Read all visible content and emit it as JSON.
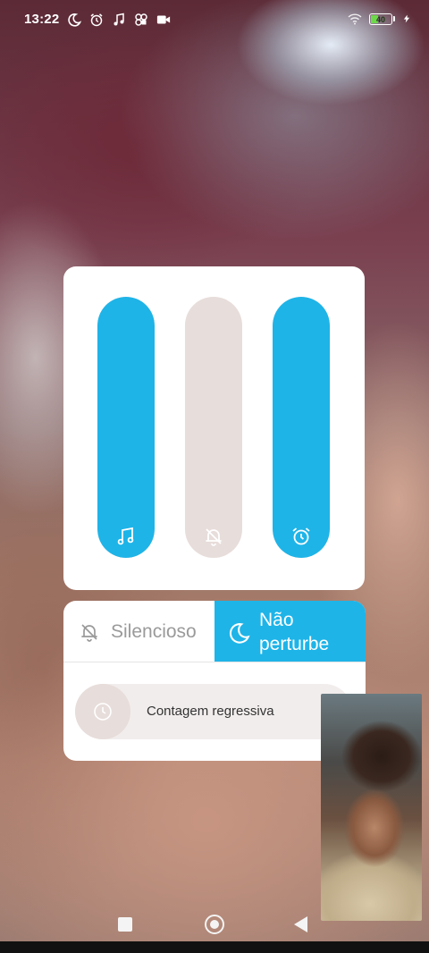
{
  "status_bar": {
    "time": "13:22",
    "left_icons": [
      "moon-icon",
      "alarm-icon",
      "music-icon",
      "app-icon",
      "video-camera-icon"
    ],
    "right_icons": [
      "wifi-icon",
      "battery-icon",
      "charging-icon"
    ],
    "battery_percent": "40",
    "battery_color": "#6ed84b"
  },
  "volume_panel": {
    "accent_color": "#1eb4e8",
    "track_color": "#e7ddda",
    "sliders": [
      {
        "name": "media",
        "icon": "music-note-icon",
        "level": 1.0
      },
      {
        "name": "ring",
        "icon": "bell-muted-icon",
        "level": 0.0
      },
      {
        "name": "alarm",
        "icon": "alarm-clock-icon",
        "level": 1.0
      }
    ]
  },
  "sound_modes": {
    "silent_label": "Silencioso",
    "dnd_label": "Não perturbe",
    "active_mode": "dnd",
    "timer_label": "Contagem regressiva"
  },
  "navigation_bar": {
    "buttons": [
      "recents-button",
      "home-button",
      "back-button"
    ]
  }
}
